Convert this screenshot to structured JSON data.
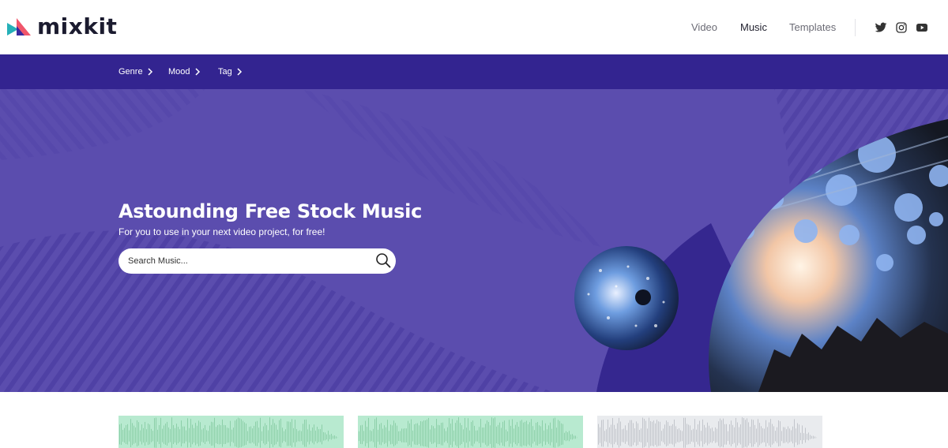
{
  "brand": {
    "name": "mixkit",
    "logo_icon": "mixkit-logo-icon"
  },
  "nav": {
    "items": [
      {
        "label": "Video",
        "active": false
      },
      {
        "label": "Music",
        "active": true
      },
      {
        "label": "Templates",
        "active": false
      }
    ],
    "social": [
      {
        "icon": "twitter-icon"
      },
      {
        "icon": "instagram-icon"
      },
      {
        "icon": "youtube-icon"
      }
    ]
  },
  "subnav": {
    "items": [
      {
        "label": "Genre",
        "icon": "chevron-right-icon"
      },
      {
        "label": "Mood",
        "icon": "chevron-right-icon"
      },
      {
        "label": "Tag",
        "icon": "chevron-right-icon"
      }
    ]
  },
  "hero": {
    "title": "Astounding Free Stock Music",
    "subtitle": "For you to use in your next video project, for free!",
    "search": {
      "placeholder": "Search Music...",
      "value": "",
      "icon": "search-icon"
    }
  },
  "tracks": [
    {
      "waveform_color": "#8ccfa8",
      "background": "#b8ead0"
    },
    {
      "waveform_color": "#8ccfa8",
      "background": "#b8ead0"
    },
    {
      "waveform_color": "#c2c5cb",
      "background": "#e9ebee"
    }
  ],
  "colors": {
    "header_bg": "#ffffff",
    "subnav_bg": "#332490",
    "hero_bg": "#5b4dae",
    "accent_dark": "#35278f",
    "logo_teal": "#25b0b8",
    "logo_coral": "#f0566b"
  }
}
